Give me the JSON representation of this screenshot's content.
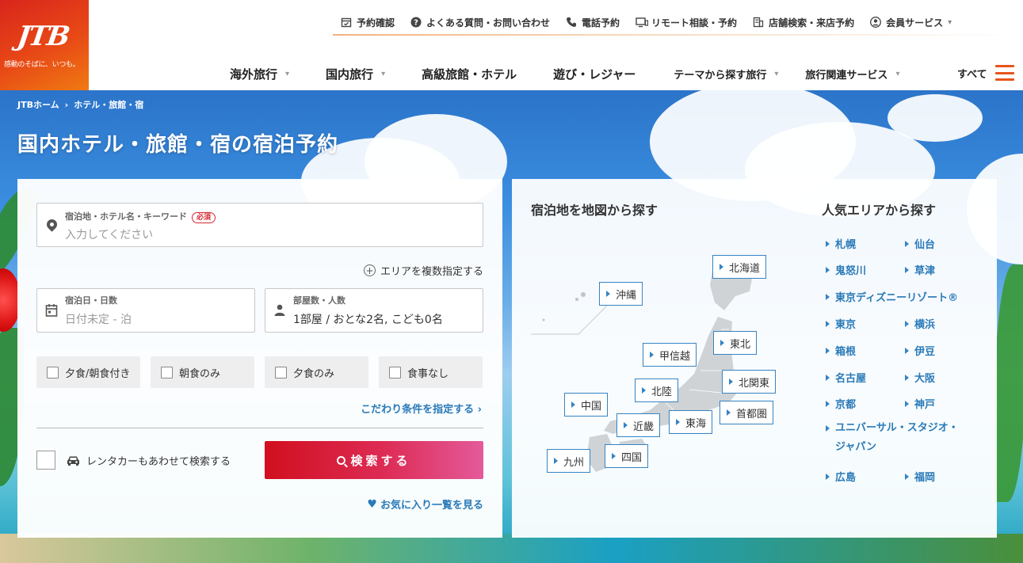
{
  "logo": {
    "text": "JTB",
    "tagline": "感動のそばに、いつも。"
  },
  "utility_nav": [
    {
      "label": "予約確認",
      "icon": "calendar-check-icon"
    },
    {
      "label": "よくある質問・お問い合わせ",
      "icon": "question-circle-icon"
    },
    {
      "label": "電話予約",
      "icon": "phone-icon"
    },
    {
      "label": "リモート相談・予約",
      "icon": "monitor-icon"
    },
    {
      "label": "店舗検索・来店予約",
      "icon": "building-icon"
    },
    {
      "label": "会員サービス",
      "icon": "user-icon"
    }
  ],
  "main_nav": [
    {
      "label": "海外旅行"
    },
    {
      "label": "国内旅行"
    },
    {
      "label": "高級旅館・ホテル"
    },
    {
      "label": "遊び・レジャー"
    },
    {
      "label": "テーマから探す旅行"
    },
    {
      "label": "旅行関連サービス"
    }
  ],
  "menu_all": "すべて",
  "breadcrumb": {
    "home": "JTBホーム",
    "current": "ホテル・旅館・宿"
  },
  "page_title": "国内ホテル・旅館・宿の宿泊予約",
  "search": {
    "destination_label": "宿泊地・ホテル名・キーワード",
    "required_badge": "必須",
    "destination_placeholder": "入力してください",
    "multi_area": "エリアを複数指定する",
    "date_label": "宿泊日・日数",
    "date_placeholder": "日付未定 - 泊",
    "guests_label": "部屋数・人数",
    "guests_value": "1部屋 / おとな2名, こども0名",
    "meals": [
      "夕食/朝食付き",
      "朝食のみ",
      "夕食のみ",
      "食事なし"
    ],
    "advanced": "こだわり条件を指定する ›",
    "rentacar": "レンタカーもあわせて検索する",
    "button": "検索する",
    "favorites": "お気に入り一覧を見る"
  },
  "map": {
    "heading": "宿泊地を地図から探す",
    "regions": [
      "北海道",
      "沖縄",
      "東北",
      "甲信越",
      "北関東",
      "北陸",
      "首都圏",
      "中国",
      "東海",
      "近畿",
      "九州",
      "四国"
    ]
  },
  "popular": {
    "heading": "人気エリアから探す",
    "areas": [
      "札幌",
      "仙台",
      "鬼怒川",
      "草津",
      "東京ディズニーリゾート®",
      "東京",
      "横浜",
      "箱根",
      "伊豆",
      "名古屋",
      "大阪",
      "京都",
      "神戸",
      "ユニバーサル・スタジオ・ジャパン",
      "広島",
      "福岡"
    ]
  },
  "colors": {
    "brand": "#e8541c",
    "link": "#2a7ab8",
    "button_start": "#d10f1f",
    "button_end": "#e45a9a"
  }
}
